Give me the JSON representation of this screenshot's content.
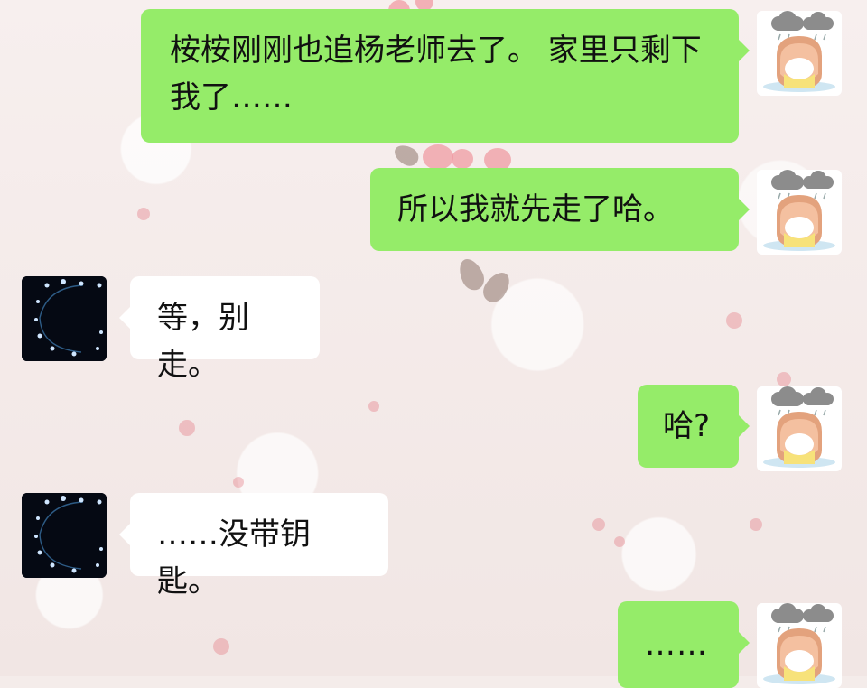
{
  "messages": [
    {
      "text": "桉桉刚刚也追杨老师去了。 家里只剩下我了……",
      "avatar": "cartoon-girl-rain-cloud"
    },
    {
      "text": "所以我就先走了哈。",
      "avatar": "cartoon-girl-rain-cloud"
    },
    {
      "text": "等，别走。",
      "avatar": "dark-constellation-avatar"
    },
    {
      "text": "哈?",
      "avatar": "cartoon-girl-rain-cloud"
    },
    {
      "text": "……没带钥匙。",
      "avatar": "dark-constellation-avatar"
    },
    {
      "text": "……",
      "avatar": "cartoon-girl-rain-cloud"
    }
  ],
  "colors": {
    "sent_bubble": "#95ec69",
    "received_bubble": "#ffffff",
    "background": "#f4ecea"
  }
}
